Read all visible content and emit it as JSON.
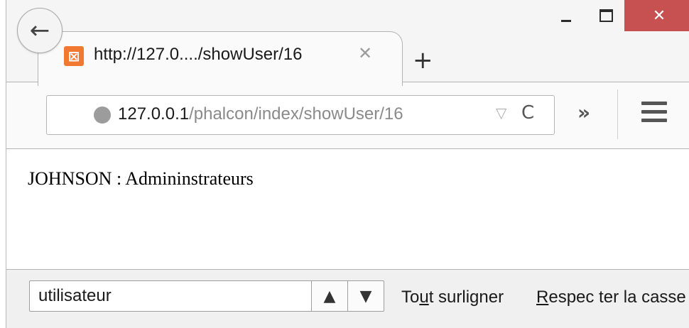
{
  "window": {
    "close_glyph": "✕"
  },
  "tab": {
    "title": "http://127.0..../showUser/16",
    "favicon_glyph": "ఔ",
    "close_glyph": "✕",
    "new_tab_glyph": "+"
  },
  "navbar": {
    "back_glyph": "←",
    "url_host": "127.0.0.1",
    "url_path": "/phalcon/index/showUser/16",
    "dropdown_glyph": "▽",
    "reload_glyph": "C",
    "overflow_glyph": "»"
  },
  "content": {
    "text": "JOHNSON : Admininstrateurs"
  },
  "findbar": {
    "query": "utilisateur",
    "prev_glyph": "⌃",
    "next_glyph": "⌄",
    "highlight_all": {
      "pre": "To",
      "accesskey": "u",
      "post": "t surligner"
    },
    "match_case": {
      "pre": "",
      "accesskey": "R",
      "post": "espec ter la casse"
    }
  },
  "colors": {
    "close_button": "#c75050",
    "favicon": "#f07830"
  }
}
